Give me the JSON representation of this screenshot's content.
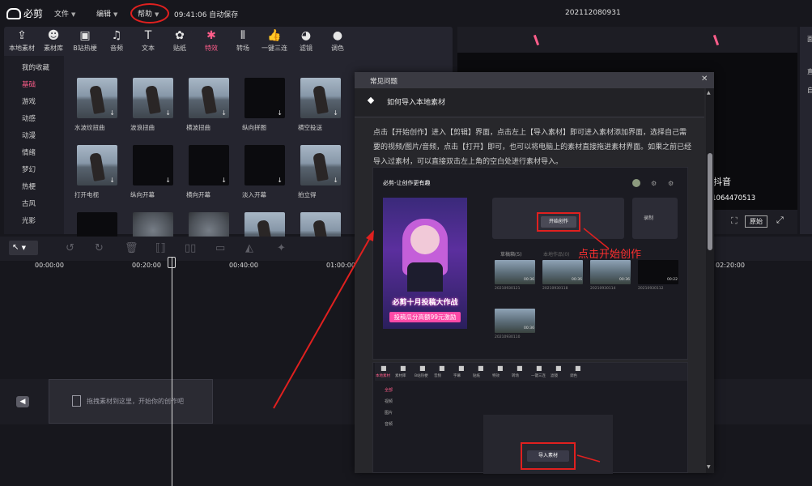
{
  "menubar": {
    "logo_text": "必剪",
    "menus": [
      "文件",
      "编辑",
      "帮助"
    ],
    "save_status": "09:41:06 自动保存",
    "project_title": "202112080931"
  },
  "toolbar": {
    "tools": [
      {
        "label": "本地素材",
        "icon": "upload-icon"
      },
      {
        "label": "素材库",
        "icon": "face-icon"
      },
      {
        "label": "B站热梗",
        "icon": "tv-icon"
      },
      {
        "label": "音频",
        "icon": "music-icon"
      },
      {
        "label": "文本",
        "icon": "text-icon"
      },
      {
        "label": "贴纸",
        "icon": "sticker-icon"
      },
      {
        "label": "特效",
        "icon": "effects-icon"
      },
      {
        "label": "转场",
        "icon": "transition-icon"
      },
      {
        "label": "一键三连",
        "icon": "thumbs-up-icon"
      },
      {
        "label": "滤镜",
        "icon": "palette-icon"
      },
      {
        "label": "调色",
        "icon": "color-icon"
      }
    ],
    "active": "特效"
  },
  "categories": [
    "我的收藏",
    "基础",
    "游戏",
    "动感",
    "动漫",
    "情绪",
    "梦幻",
    "热梗",
    "古风",
    "光影"
  ],
  "active_category": "基础",
  "effects": [
    {
      "label": "水波纹扭曲",
      "style": "img"
    },
    {
      "label": "波浪扭曲",
      "style": "img"
    },
    {
      "label": "横波扭曲",
      "style": "img"
    },
    {
      "label": "纵向拼图",
      "style": "dark"
    },
    {
      "label": "横空投送",
      "style": "img"
    },
    {
      "label": "打开电视",
      "style": "img"
    },
    {
      "label": "纵向开幕",
      "style": "dark"
    },
    {
      "label": "横向开幕",
      "style": "dark"
    },
    {
      "label": "淡入开幕",
      "style": "dark"
    },
    {
      "label": "拍立得",
      "style": "img"
    },
    {
      "label": "",
      "style": "dark"
    },
    {
      "label": "",
      "style": "blur"
    },
    {
      "label": "",
      "style": "blur"
    },
    {
      "label": "",
      "style": "img"
    },
    {
      "label": "",
      "style": "img"
    }
  ],
  "preview": {
    "watermark": "抖音",
    "watermark_id": "1064470513",
    "ratio_button": "原始"
  },
  "timeline": {
    "ruler": [
      "00:00:00",
      "00:20:00",
      "00:40:00",
      "01:00:00",
      "02:20:00"
    ],
    "drop_hint": "拖拽素材到这里，开始你的创作吧"
  },
  "dialog": {
    "title": "常见问题",
    "question": "如何导入本地素材",
    "answer": "点击【开始创作】进入【剪辑】界面，点击左上【导入素材】即可进入素材添加界面，选择自己需要的视频/图片/音频，点击【打开】即可，也可以将电脑上的素材直接拖进素材界面。如果之前已经导入过素材，可以直接双击左上角的空白处进行素材导入。",
    "shot1": {
      "header": "必剪-让创作更有趣",
      "poster_title": "必剪十月投稿大作战",
      "poster_button": "投稿瓜分高额99元激励",
      "start_create": "开始创作",
      "record": "录制",
      "tab_drafts": "草稿箱(5)",
      "tab_works": "本地作品(0)",
      "annotation": "点击开始创作",
      "drafts": [
        {
          "date": "20210930121",
          "time": "00:36"
        },
        {
          "date": "20210930118",
          "time": "00:36"
        },
        {
          "date": "20210930114",
          "time": "00:36"
        },
        {
          "date": "20210930112",
          "time": "00:22"
        },
        {
          "date": "20210930110",
          "time": "00:36"
        }
      ]
    },
    "shot2": {
      "tools": [
        "本地素材",
        "素材库",
        "B站热梗",
        "音频",
        "字幕",
        "贴纸",
        "特效",
        "转场",
        "一键三连",
        "滤镜",
        "调色"
      ],
      "categories": [
        "全部",
        "视频",
        "图片",
        "音频"
      ],
      "import_button": "导入素材"
    }
  }
}
